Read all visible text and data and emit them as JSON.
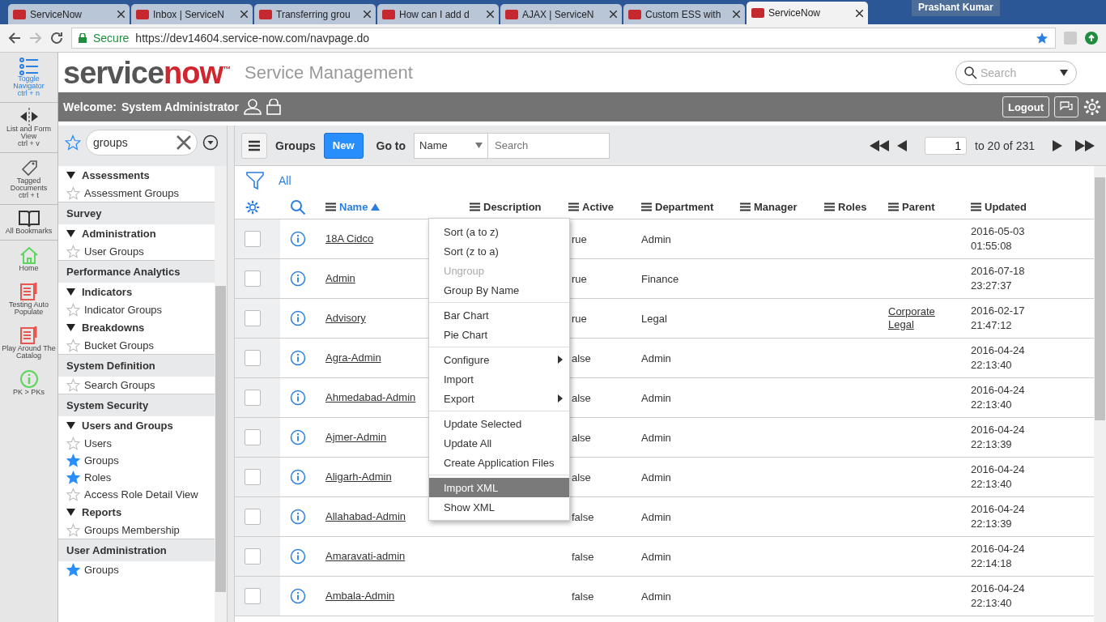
{
  "browser": {
    "tabs": [
      {
        "title": "ServiceNow",
        "selected": false
      },
      {
        "title": "Inbox | ServiceN",
        "selected": false
      },
      {
        "title": "Transferring grou",
        "selected": false
      },
      {
        "title": "How can I add d",
        "selected": false
      },
      {
        "title": "AJAX | ServiceN",
        "selected": false
      },
      {
        "title": "Custom ESS with",
        "selected": false
      },
      {
        "title": "ServiceNow",
        "selected": true
      }
    ],
    "user": "Prashant Kumar",
    "secure": "Secure",
    "url": "https://dev14604.service-now.com/navpage.do"
  },
  "header": {
    "logo": [
      "service",
      "now"
    ],
    "logo_mark": "™",
    "title": "Service Management",
    "search_placeholder": "Search",
    "welcome": "Welcome:",
    "user_name": "System Administrator",
    "logout": "Logout"
  },
  "rail": [
    {
      "label": "Toggle Navigator",
      "shortcut": "ctrl + n",
      "kind": "list",
      "active": true
    },
    {
      "label": "List and Form View",
      "shortcut": "ctrl + v",
      "kind": "split",
      "active": false
    },
    {
      "label": "Tagged Documents",
      "shortcut": "ctrl + t",
      "kind": "tag",
      "active": false
    },
    {
      "label": "All Bookmarks",
      "kind": "book",
      "active": false
    },
    {
      "label": "Home",
      "kind": "home",
      "active": false
    },
    {
      "label": "Testing Auto Populate",
      "kind": "doc",
      "active": false
    },
    {
      "label": "Play Around The Catalog",
      "kind": "doc",
      "active": false
    },
    {
      "label": "PK > PKs",
      "kind": "info",
      "active": false
    }
  ],
  "navigator": {
    "filter": "groups",
    "entries": [
      {
        "kind": "group",
        "label": "Assessments"
      },
      {
        "kind": "item",
        "label": "Assessment Groups",
        "starred": false
      },
      {
        "kind": "section",
        "label": "Survey"
      },
      {
        "kind": "group",
        "label": "Administration"
      },
      {
        "kind": "item",
        "label": "User Groups",
        "starred": false
      },
      {
        "kind": "section",
        "label": "Performance Analytics"
      },
      {
        "kind": "group",
        "label": "Indicators"
      },
      {
        "kind": "item",
        "label": "Indicator Groups",
        "starred": false
      },
      {
        "kind": "group",
        "label": "Breakdowns"
      },
      {
        "kind": "item",
        "label": "Bucket Groups",
        "starred": false
      },
      {
        "kind": "section",
        "label": "System Definition"
      },
      {
        "kind": "item",
        "label": "Search Groups",
        "starred": false
      },
      {
        "kind": "section",
        "label": "System Security"
      },
      {
        "kind": "group",
        "label": "Users and Groups"
      },
      {
        "kind": "item",
        "label": "Users",
        "starred": false
      },
      {
        "kind": "item",
        "label": "Groups",
        "starred": true
      },
      {
        "kind": "item",
        "label": "Roles",
        "starred": true
      },
      {
        "kind": "item",
        "label": "Access Role Detail View",
        "starred": false
      },
      {
        "kind": "group",
        "label": "Reports"
      },
      {
        "kind": "item",
        "label": "Groups Membership",
        "starred": false
      },
      {
        "kind": "section",
        "label": "User Administration"
      },
      {
        "kind": "item",
        "label": "Groups",
        "starred": true
      }
    ]
  },
  "list": {
    "title": "Groups",
    "new_button": "New",
    "goto_label": "Go to",
    "goto_field": "Name",
    "search_placeholder": "Search",
    "page": "1",
    "range": "to 20 of 231",
    "filter": "All",
    "columns": [
      {
        "label": "Name",
        "sorted": true
      },
      {
        "label": "Description",
        "sorted": false
      },
      {
        "label": "Active",
        "sorted": false
      },
      {
        "label": "Department",
        "sorted": false
      },
      {
        "label": "Manager",
        "sorted": false
      },
      {
        "label": "Roles",
        "sorted": false
      },
      {
        "label": "Parent",
        "sorted": false
      },
      {
        "label": "Updated",
        "sorted": false
      }
    ],
    "rows": [
      {
        "checked": false,
        "name": "18A Cidco",
        "active": "rue",
        "department": "Admin",
        "updated": "2016-05-03 01:55:08"
      },
      {
        "checked": false,
        "name": "Admin",
        "active": "rue",
        "department": "Finance",
        "updated": "2016-07-18 23:27:37"
      },
      {
        "checked": false,
        "name": "Advisory",
        "active": "rue",
        "department": "Legal",
        "parent": "Corporate Legal",
        "updated": "2016-02-17 21:47:12"
      },
      {
        "checked": false,
        "name": "Agra-Admin",
        "active": "alse",
        "department": "Admin",
        "updated": "2016-04-24 22:13:40"
      },
      {
        "checked": false,
        "name": "Ahmedabad-Admin",
        "active": "alse",
        "department": "Admin",
        "updated": "2016-04-24 22:13:40"
      },
      {
        "checked": false,
        "name": "Ajmer-Admin",
        "active": "alse",
        "department": "Admin",
        "updated": "2016-04-24 22:13:39"
      },
      {
        "checked": false,
        "name": "Aligarh-Admin",
        "active": "alse",
        "department": "Admin",
        "updated": "2016-04-24 22:13:40"
      },
      {
        "checked": false,
        "name": "Allahabad-Admin",
        "active": "false",
        "department": "Admin",
        "updated": "2016-04-24 22:13:39"
      },
      {
        "checked": false,
        "name": "Amaravati-admin",
        "active": "false",
        "department": "Admin",
        "updated": "2016-04-24 22:14:18"
      },
      {
        "checked": false,
        "name": "Ambala-Admin",
        "active": "false",
        "department": "Admin",
        "updated": "2016-04-24 22:13:40"
      }
    ],
    "context_menu": [
      [
        {
          "label": "Sort (a to z)",
          "disabled": false,
          "selected": false,
          "submenu": false
        },
        {
          "label": "Sort (z to a)",
          "disabled": false,
          "selected": false,
          "submenu": false
        },
        {
          "label": "Ungroup",
          "disabled": true,
          "selected": false,
          "submenu": false
        },
        {
          "label": "Group By Name",
          "disabled": false,
          "selected": false,
          "submenu": false
        }
      ],
      [
        {
          "label": "Bar Chart",
          "disabled": false,
          "selected": false,
          "submenu": false
        },
        {
          "label": "Pie Chart",
          "disabled": false,
          "selected": false,
          "submenu": false
        }
      ],
      [
        {
          "label": "Configure",
          "disabled": false,
          "selected": false,
          "submenu": true
        },
        {
          "label": "Import",
          "disabled": false,
          "selected": false,
          "submenu": false
        },
        {
          "label": "Export",
          "disabled": false,
          "selected": false,
          "submenu": true
        }
      ],
      [
        {
          "label": "Update Selected",
          "disabled": false,
          "selected": false,
          "submenu": false
        },
        {
          "label": "Update All",
          "disabled": false,
          "selected": false,
          "submenu": false
        },
        {
          "label": "Create Application Files",
          "disabled": false,
          "selected": false,
          "submenu": false
        }
      ],
      [
        {
          "label": "Import XML",
          "disabled": false,
          "selected": true,
          "submenu": false
        },
        {
          "label": "Show XML",
          "disabled": false,
          "selected": false,
          "submenu": false
        }
      ]
    ]
  }
}
